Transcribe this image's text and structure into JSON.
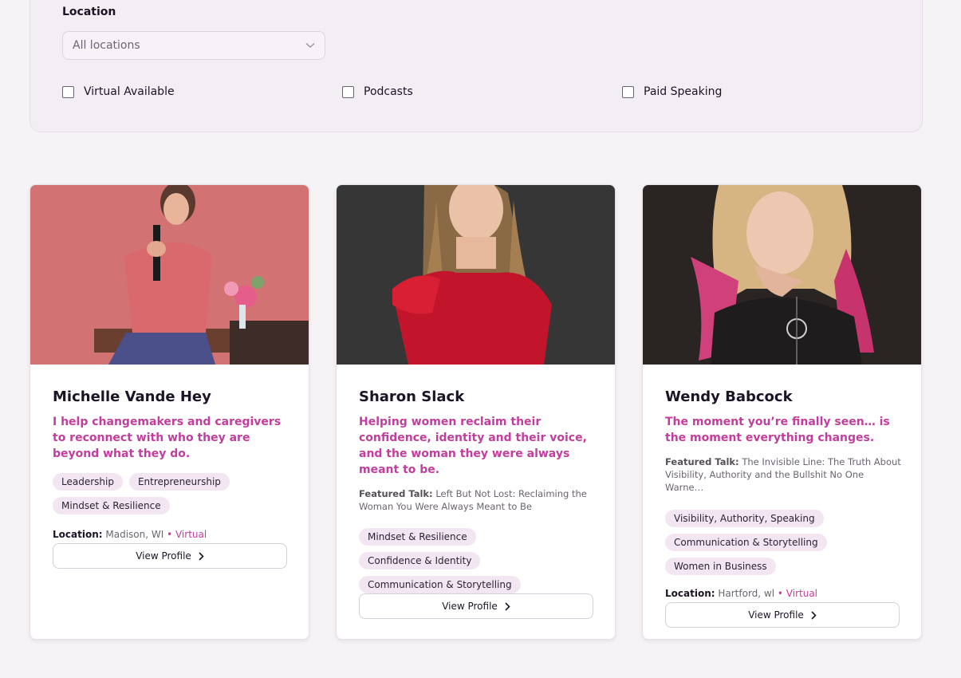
{
  "filters": {
    "location_label": "Location",
    "location_select": {
      "value": "All locations"
    },
    "checkboxes": [
      {
        "label": "Virtual Available",
        "checked": false
      },
      {
        "label": "Podcasts",
        "checked": false
      },
      {
        "label": "Paid Speaking",
        "checked": false
      }
    ]
  },
  "speakers": [
    {
      "name": "Michelle Vande Hey",
      "tagline": "I help changemakers and caregivers to reconnect with who they are beyond what they do.",
      "featured_talk_label": "",
      "featured_talk": "",
      "tags": [
        "Leadership",
        "Entrepreneurship",
        "Mindset & Resilience"
      ],
      "location_label": "Location:",
      "location": "Madison, WI",
      "virtual": "• Virtual",
      "button_label": "View Profile"
    },
    {
      "name": "Sharon Slack",
      "tagline": "Helping women reclaim their confidence, identity and their voice, and the woman they were always meant to be.",
      "featured_talk_label": "Featured Talk:",
      "featured_talk": "Left But Not Lost: Reclaiming the Woman You Were Always Meant to Be",
      "tags": [
        "Mindset & Resilience",
        "Confidence & Identity",
        "Communication & Storytelling"
      ],
      "location_label": "",
      "location": "",
      "virtual": "",
      "button_label": "View Profile"
    },
    {
      "name": "Wendy Babcock",
      "tagline": "The moment you’re finally seen… is the moment everything changes.",
      "featured_talk_label": "Featured Talk:",
      "featured_talk": "The Invisible Line: The Truth About Visibility, Authority and the Bullshit No One Warne…",
      "tags": [
        "Visibility, Authority, Speaking",
        "Communication & Storytelling",
        "Women in Business"
      ],
      "location_label": "Location:",
      "location": "Hartford, wl",
      "virtual": "• Virtual",
      "button_label": "View Profile"
    }
  ],
  "colors": {
    "accent": "#c23d9d",
    "tag_bg": "#f3e6f3",
    "panel_bg": "#f3eef4"
  },
  "icons": {
    "select": "chevron-down-icon",
    "button": "chevron-right-icon"
  }
}
